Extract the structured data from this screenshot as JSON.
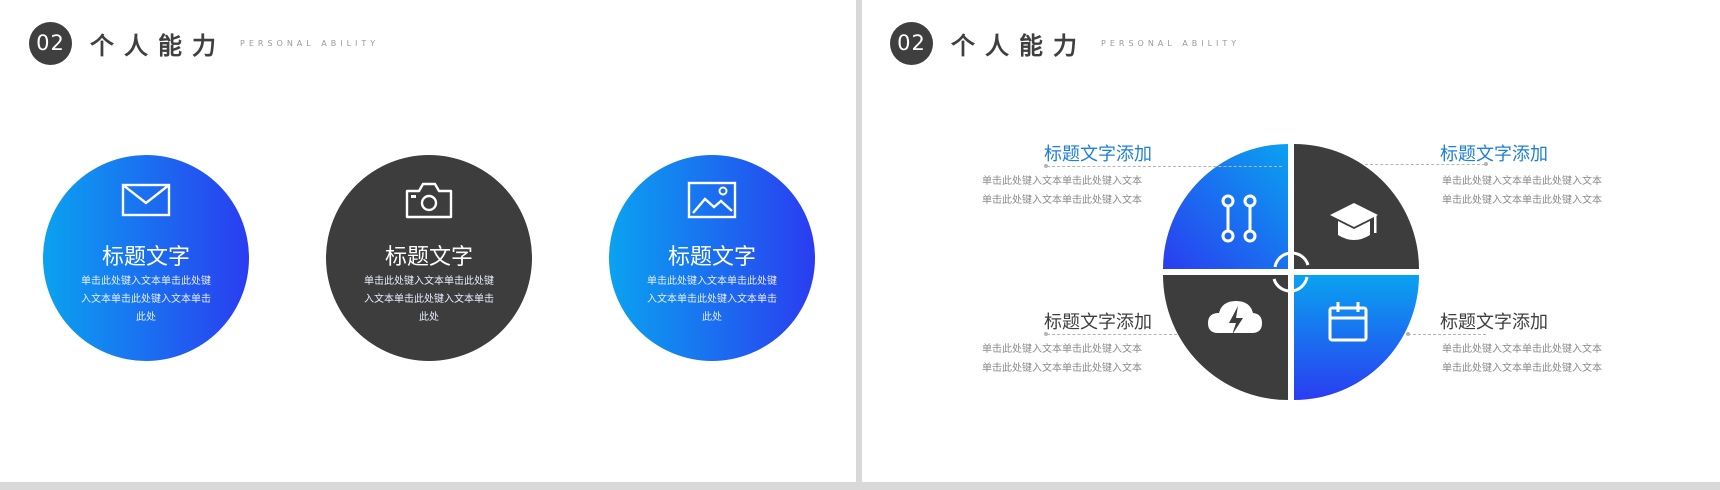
{
  "header": {
    "number": "02",
    "title": "个人能力",
    "subtitle": "PERSONAL ABILITY"
  },
  "left_slide": {
    "cards": [
      {
        "title": "标题文字",
        "body": "单击此处键入文本单击此处键入文本单击此处键入文本单击此处",
        "icon": "envelope-icon"
      },
      {
        "title": "标题文字",
        "body": "单击此处键入文本单击此处键入文本单击此处键入文本单击此处",
        "icon": "camera-icon"
      },
      {
        "title": "标题文字",
        "body": "单击此处键入文本单击此处键入文本单击此处键入文本单击此处",
        "icon": "image-icon"
      }
    ]
  },
  "right_slide": {
    "items": [
      {
        "title": "标题文字添加",
        "line1": "单击此处键入文本单击此处键入文本",
        "line2": "单击此处键入文本单击此处键入文本"
      },
      {
        "title": "标题文字添加",
        "line1": "单击此处键入文本单击此处键入文本",
        "line2": "单击此处键入文本单击此处键入文本"
      },
      {
        "title": "标题文字添加",
        "line1": "单击此处键入文本单击此处键入文本",
        "line2": "单击此处键入文本单击此处键入文本"
      },
      {
        "title": "标题文字添加",
        "line1": "单击此处键入文本单击此处键入文本",
        "line2": "单击此处键入文本单击此处键入文本"
      }
    ],
    "quadrant_icons": [
      "link-icon",
      "graduation-cap-icon",
      "cloud-lightning-icon",
      "calendar-icon"
    ]
  },
  "colors": {
    "accent_blue": "#1e7fd8",
    "dark": "#3d3d3d",
    "gradient_start": "#0aa2f0",
    "gradient_end": "#2a3df0"
  }
}
